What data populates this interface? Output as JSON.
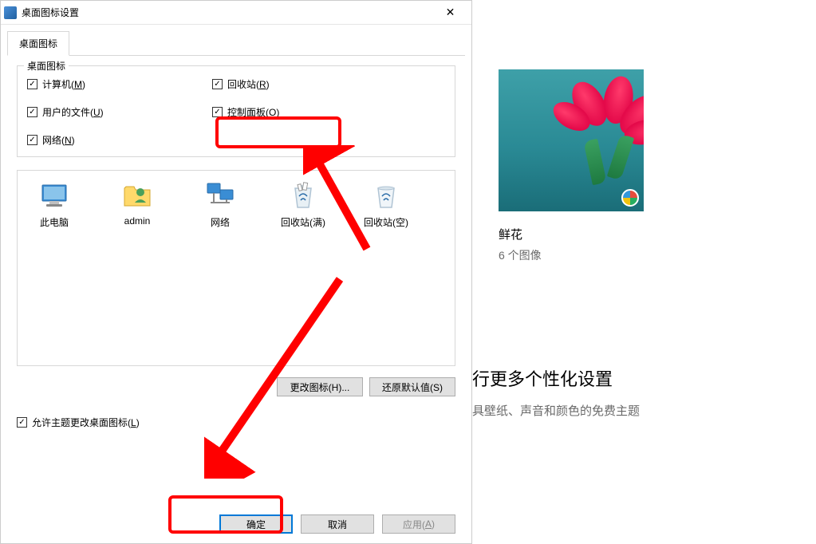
{
  "dialog": {
    "title": "桌面图标设置",
    "close": "✕",
    "tab": "桌面图标",
    "group_label": "桌面图标",
    "checkboxes": {
      "computer": {
        "label": "计算机(",
        "key": "M",
        "suffix": ")"
      },
      "recycle": {
        "label": "回收站(",
        "key": "R",
        "suffix": ")"
      },
      "userfiles": {
        "label": "用户的文件(",
        "key": "U",
        "suffix": ")"
      },
      "controlpanel": {
        "label": "控制面板(",
        "key": "O",
        "suffix": ")"
      },
      "network": {
        "label": "网络(",
        "key": "N",
        "suffix": ")"
      }
    },
    "icons": {
      "thispc": "此电脑",
      "admin": "admin",
      "network": "网络",
      "recycle_full": "回收站(满)",
      "recycle_empty": "回收站(空)"
    },
    "buttons": {
      "change_icon": "更改图标(H)...",
      "restore": "还原默认值(S)",
      "ok": "确定",
      "cancel": "取消",
      "apply_prefix": "应用(",
      "apply_key": "A",
      "apply_suffix": ")"
    },
    "allow_themes": {
      "label": "允许主题更改桌面图标(",
      "key": "L",
      "suffix": ")"
    }
  },
  "background": {
    "theme_title": "鲜花",
    "theme_sub": "6 个图像",
    "heading": "行更多个性化设置",
    "sub": "具壁纸、声音和颜色的免费主题"
  }
}
